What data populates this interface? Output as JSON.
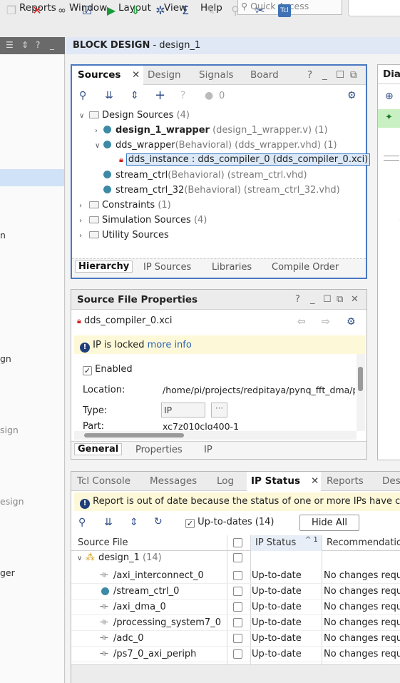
{
  "menu": {
    "items": [
      {
        "label": "Reports"
      },
      {
        "label": "Window"
      },
      {
        "label": "Layout"
      },
      {
        "label": "View"
      },
      {
        "label": "Help"
      }
    ],
    "quick_access_placeholder": "Quick Access"
  },
  "toolbar": {
    "tcl_label": "Tcl"
  },
  "left_panel": {
    "labels": [
      "n",
      "gn",
      "sign",
      "esign",
      "ger"
    ]
  },
  "block_design": {
    "title": "BLOCK DESIGN",
    "subtitle": "- design_1"
  },
  "sources": {
    "tabs": [
      "Sources",
      "Design",
      "Signals",
      "Board"
    ],
    "help": "?",
    "count": "0",
    "tree": {
      "design_sources": {
        "label": "Design Sources",
        "count": "(4)"
      },
      "wrapper": {
        "name": "design_1_wrapper",
        "file": "(design_1_wrapper.v)",
        "count": "(1)"
      },
      "dds_wrapper": {
        "name": "dds_wrapper",
        "kind": "(Behavioral)",
        "file": "(dds_wrapper.vhd)",
        "count": "(1)"
      },
      "dds_instance": {
        "label": "dds_instance : dds_compiler_0 (dds_compiler_0.xci)"
      },
      "stream_ctrl": {
        "name": "stream_ctrl",
        "kind": "(Behavioral)",
        "file": "(stream_ctrl.vhd)"
      },
      "stream_ctrl_32": {
        "name": "stream_ctrl_32",
        "kind": "(Behavioral)",
        "file": "(stream_ctrl_32.vhd)"
      },
      "constraints": {
        "label": "Constraints",
        "count": "(1)"
      },
      "simulation": {
        "label": "Simulation Sources",
        "count": "(4)"
      },
      "utility": {
        "label": "Utility Sources"
      }
    },
    "bottom_tabs": [
      "Hierarchy",
      "IP Sources",
      "Libraries",
      "Compile Order"
    ]
  },
  "diagram_tab": {
    "label": "Dia"
  },
  "source_props": {
    "title": "Source File Properties",
    "help": "?",
    "file": "dds_compiler_0.xci",
    "locked_text": "IP is locked",
    "more_info": "more info",
    "enabled_label": "Enabled",
    "location_label": "Location:",
    "location_value": "/home/pi/projects/redpitaya/pynq_fft_dma/p",
    "type_label": "Type:",
    "type_value": "IP",
    "part_label": "Part:",
    "part_value": "xc7z010clg400-1",
    "tabs": [
      "General",
      "Properties",
      "IP"
    ]
  },
  "ip_status": {
    "tabs": [
      "Tcl Console",
      "Messages",
      "Log",
      "IP Status",
      "Reports",
      "Des"
    ],
    "warning": "Report is out of date because the status of one or more IPs have cha",
    "uptodates_label": "Up-to-dates (14)",
    "hide_all": "Hide All",
    "columns": {
      "source": "Source File",
      "status": "IP Status",
      "sort": "^ 1",
      "recommendation": "Recommendation"
    },
    "group": {
      "label": "design_1",
      "count": "(14)"
    },
    "rows": [
      {
        "name": "/axi_interconnect_0",
        "status": "Up-to-date",
        "recommendation": "No changes requ"
      },
      {
        "name": "/stream_ctrl_0",
        "status": "Up-to-date",
        "recommendation": "No changes requ"
      },
      {
        "name": "/axi_dma_0",
        "status": "Up-to-date",
        "recommendation": "No changes requ"
      },
      {
        "name": "/processing_system7_0",
        "status": "Up-to-date",
        "recommendation": "No changes requ"
      },
      {
        "name": "/adc_0",
        "status": "Up-to-date",
        "recommendation": "No changes requ"
      },
      {
        "name": "/ps7_0_axi_periph",
        "status": "Up-to-date",
        "recommendation": "No changes requ"
      }
    ]
  }
}
